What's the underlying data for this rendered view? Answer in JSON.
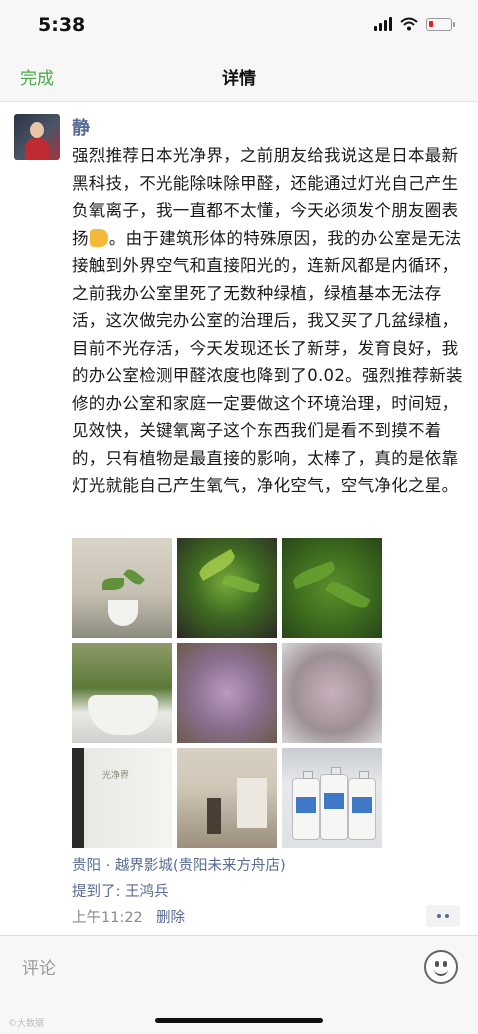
{
  "status_bar": {
    "time": "5:38",
    "battery_level": 0.2,
    "battery_color": "#e02020"
  },
  "nav": {
    "done_label": "完成",
    "title": "详情"
  },
  "post": {
    "author": "静",
    "text": "强烈推荐日本光净界，之前朋友给我说这是日本最新黑科技，不光能除味除甲醛，还能通过灯光自己产生负氧离子，我一直都不太懂，今天必须发个朋友圈表扬",
    "text_after_emoji": "。由于建筑形体的特殊原因，我的办公室是无法接触到外界空气和直接阳光的，连新风都是内循环，之前我办公室里死了无数种绿植，绿植基本无法存活，这次做完办公室的治理后，我又买了几盆绿植，目前不光存活，今天发现还长了新芽，发育良好，我的办公室检测甲醛浓度也降到了0.02。强烈推荐新装修的办公室和家庭一定要做这个环境治理，时间短，见效快，关键氧离子这个东西我们是看不到摸不着的，只有植物是最直接的影响，太棒了，真的是依靠灯光就能自己产生氧气，净化空气，空气净化之星。",
    "emoji": "thumbs-up-icon",
    "photos": [
      {
        "name": "office-plants-photo"
      },
      {
        "name": "sprouting-plant-photo"
      },
      {
        "name": "plant-leaves-photo"
      },
      {
        "name": "potted-plant-photo"
      },
      {
        "name": "purple-plant-photo"
      },
      {
        "name": "pink-plant-photo"
      },
      {
        "name": "product-box-photo",
        "label": "光净界"
      },
      {
        "name": "office-room-photo"
      },
      {
        "name": "bottles-photo"
      }
    ],
    "location": "贵阳 · 越界影城(贵阳未来方舟店)",
    "mentions": "提到了: 王鸿兵",
    "time": "上午11:22",
    "delete_label": "删除"
  },
  "comment_bar": {
    "placeholder": "评论"
  },
  "watermark": "©大数据"
}
